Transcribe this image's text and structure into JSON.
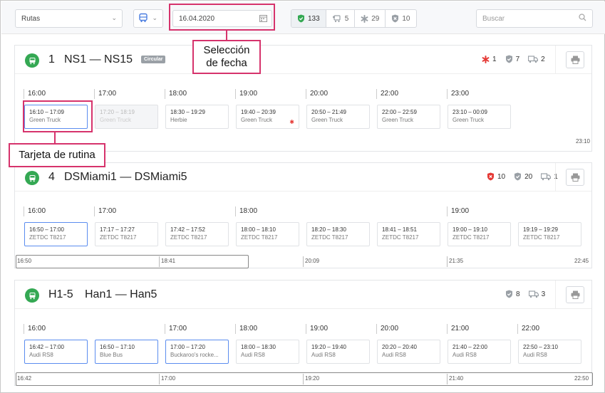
{
  "topbar": {
    "route_select": "Rutas",
    "date": "16.04.2020",
    "search_placeholder": "Buscar",
    "stats": [
      {
        "icon": "shield-check-icon",
        "value": "133",
        "color": "#34a853"
      },
      {
        "icon": "truck-people-icon",
        "value": "5",
        "color": "#9aa0a6"
      },
      {
        "icon": "asterisk-icon",
        "value": "29",
        "color": "#9aa0a6"
      },
      {
        "icon": "shield-x-icon",
        "value": "10",
        "color": "#9aa0a6"
      }
    ]
  },
  "callouts": {
    "date": "Selección de fecha",
    "card": "Tarjeta de rutina"
  },
  "routes": [
    {
      "number": "1",
      "name": "NS1 — NS15",
      "badge": "Circular",
      "stats": [
        {
          "icon": "asterisk-icon",
          "value": "1",
          "color": "#e53935"
        },
        {
          "icon": "shield-check-icon",
          "value": "7",
          "color": "#9aa0a6"
        },
        {
          "icon": "truck-icon",
          "value": "2",
          "color": "#9aa0a6"
        }
      ],
      "hours": [
        "16:00",
        "17:00",
        "18:00",
        "19:00",
        "20:00",
        "22:00",
        "23:00"
      ],
      "cards": [
        {
          "time": "16:10 – 17:09",
          "vehicle": "Green Truck",
          "state": "selected"
        },
        {
          "time": "17:20 – 18:19",
          "vehicle": "Green Truck",
          "state": "past"
        },
        {
          "time": "18:30 – 19:29",
          "vehicle": "Herbie",
          "state": ""
        },
        {
          "time": "19:40 – 20:39",
          "vehicle": "Green Truck",
          "state": "",
          "alert": "✱"
        },
        {
          "time": "20:50 – 21:49",
          "vehicle": "Green Truck",
          "state": ""
        },
        {
          "time": "22:00 – 22:59",
          "vehicle": "Green Truck",
          "state": ""
        },
        {
          "time": "23:10 – 00:09",
          "vehicle": "Green Truck",
          "state": ""
        }
      ],
      "axis_end": "23:10"
    },
    {
      "number": "4",
      "name": "DSMiami1 — DSMiami5",
      "stats": [
        {
          "icon": "shield-x-icon",
          "value": "10",
          "color": "#e53935"
        },
        {
          "icon": "shield-check-icon",
          "value": "20",
          "color": "#9aa0a6"
        },
        {
          "icon": "truck-icon",
          "value": "1",
          "color": "#9aa0a6"
        }
      ],
      "hours": [
        "16:00",
        "17:00",
        "18:00",
        "19:00"
      ],
      "cards": [
        {
          "time": "16:50 – 17:00",
          "vehicle": "ZETDC T8217",
          "state": "selected"
        },
        {
          "time": "17:17 – 17:27",
          "vehicle": "ZETDC T8217",
          "state": ""
        },
        {
          "time": "17:42 – 17:52",
          "vehicle": "ZETDC T8217",
          "state": ""
        },
        {
          "time": "18:00 – 18:10",
          "vehicle": "ZETDC T8217",
          "state": ""
        },
        {
          "time": "18:20 – 18:30",
          "vehicle": "ZETDC T8217",
          "state": ""
        },
        {
          "time": "18:41 – 18:51",
          "vehicle": "ZETDC T8217",
          "state": ""
        },
        {
          "time": "19:00 – 19:10",
          "vehicle": "ZETDC T8217",
          "state": ""
        },
        {
          "time": "19:19 – 19:29",
          "vehicle": "ZETDC T8217",
          "state": ""
        }
      ],
      "axis": [
        "16:50",
        "18:41",
        "20:09",
        "21:35",
        "22:45"
      ]
    },
    {
      "number": "H1-5",
      "name": "Han1 — Han5",
      "stats": [
        {
          "icon": "shield-check-icon",
          "value": "8",
          "color": "#9aa0a6"
        },
        {
          "icon": "truck-icon",
          "value": "3",
          "color": "#9aa0a6"
        }
      ],
      "hours": [
        "16:00",
        "17:00",
        "18:00",
        "19:00",
        "20:00",
        "21:00",
        "22:00"
      ],
      "cards": [
        {
          "time": "16:42 – 17:00",
          "vehicle": "Audi RS8",
          "state": "selected"
        },
        {
          "time": "16:50 – 17:10",
          "vehicle": "Blue Bus",
          "state": "selected"
        },
        {
          "time": "17:00 – 17:20",
          "vehicle": "Buckaroo's rocke...",
          "state": "selected"
        },
        {
          "time": "18:00 – 18:30",
          "vehicle": "Audi RS8",
          "state": ""
        },
        {
          "time": "19:20 – 19:40",
          "vehicle": "Audi RS8",
          "state": ""
        },
        {
          "time": "20:20 – 20:40",
          "vehicle": "Audi RS8",
          "state": ""
        },
        {
          "time": "21:40 – 22:00",
          "vehicle": "Audi RS8",
          "state": ""
        },
        {
          "time": "22:50 – 23:10",
          "vehicle": "Audi RS8",
          "state": ""
        }
      ],
      "axis": [
        "16:42",
        "17:00",
        "19:20",
        "21:40",
        "22:50"
      ]
    }
  ]
}
